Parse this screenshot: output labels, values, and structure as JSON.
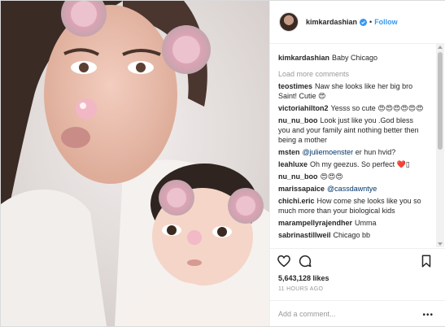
{
  "post": {
    "username": "kimkardashian",
    "follow_label": "Follow",
    "dot": "•",
    "caption_user": "kimkardashian",
    "caption_text": "Baby Chicago",
    "load_more": "Load more comments",
    "comments": [
      {
        "user": "teostimes",
        "text": "Naw she looks like her big bro Saint! Cutie 😍"
      },
      {
        "user": "victoriahilton2",
        "text": "Yesss so cute 😍😍😍😍😍😍"
      },
      {
        "user": "nu_nu_boo",
        "text": "Look just like you .God bless you and your family aint nothing better then being a mother"
      },
      {
        "user": "msten",
        "mention": "@juliemoenster",
        "text": "er hun hvid?"
      },
      {
        "user": "leahluxe",
        "text": "Oh my geezus. So perfect ❤️▯"
      },
      {
        "user": "nu_nu_boo",
        "text": "😍😍😍"
      },
      {
        "user": "marissapaice",
        "mention": "@cassdawntye",
        "text": ""
      },
      {
        "user": "chichi.eric",
        "text": "How come she looks like you so much more than your biological kids"
      },
      {
        "user": "marampellyrajendher",
        "text": "Umma"
      },
      {
        "user": "sabrinastillweil",
        "text": "Chicago bb"
      }
    ],
    "likes": "5,643,128 likes",
    "time": "11 HOURS AGO",
    "add_comment_placeholder": "Add a comment...",
    "more_label": "•••"
  },
  "icons": [
    "verified-badge-icon",
    "heart-icon",
    "comment-icon",
    "bookmark-icon",
    "more-options-icon"
  ],
  "colors": {
    "link": "#3897f0",
    "border": "#efefef",
    "muted": "#999999",
    "text": "#262626"
  }
}
